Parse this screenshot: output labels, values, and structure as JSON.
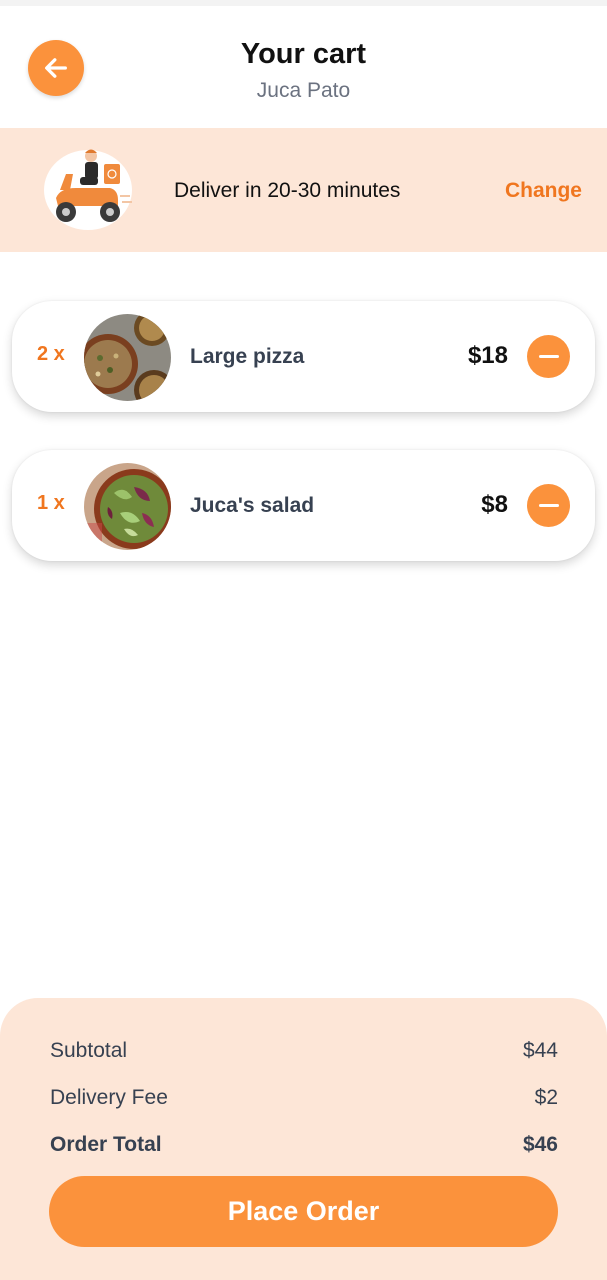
{
  "header": {
    "title": "Your cart",
    "subtitle": "Juca Pato",
    "back_icon": "arrow-left-icon"
  },
  "delivery": {
    "text": "Deliver in 20-30 minutes",
    "change_label": "Change",
    "illustration": "delivery-scooter-icon"
  },
  "items": [
    {
      "qty": "2 x",
      "name": "Large pizza",
      "price": "$18",
      "image": "pizza-photo"
    },
    {
      "qty": "1 x",
      "name": "Juca's salad",
      "price": "$8",
      "image": "salad-photo"
    }
  ],
  "summary": {
    "subtotal_label": "Subtotal",
    "subtotal_value": "$44",
    "fee_label": "Delivery Fee",
    "fee_value": "$2",
    "total_label": "Order Total",
    "total_value": "$46",
    "button_label": "Place Order"
  },
  "colors": {
    "accent": "#fb923c",
    "accent_text": "#f0761f",
    "panel_bg": "#fde6d7"
  }
}
